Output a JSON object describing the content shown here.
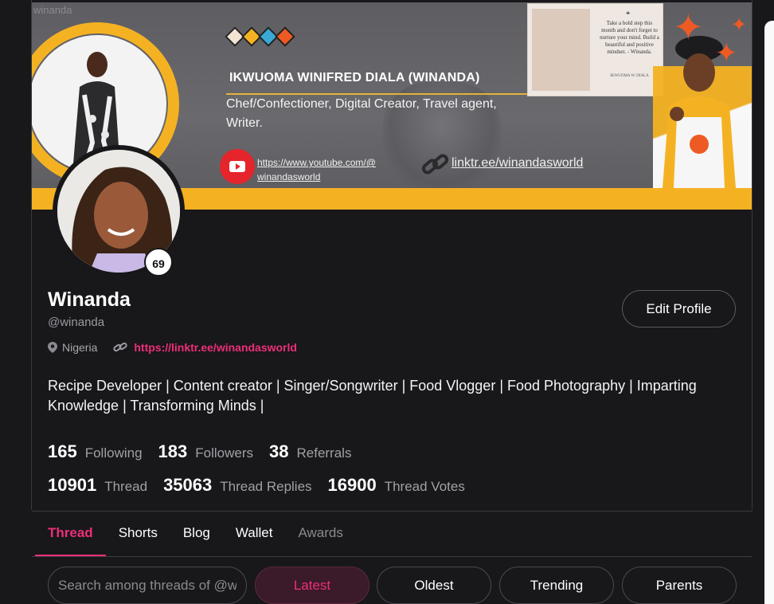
{
  "watermark": "winanda",
  "banner": {
    "name": "IKWUOMA WINIFRED DIALA (WINANDA)",
    "description": "Chef/Confectioner, Digital Creator, Travel agent, Writer.",
    "youtube_line1": "https://www.youtube.com/@",
    "youtube_line2": "winandasworld",
    "linktree": "linktr.ee/winandasworld",
    "quote_mark": "❝",
    "quote": "Take a bold step this month and don't forget to nurture your mind. Build a beautiful and positive mindset. - Winanda.",
    "quote_signature": "IKWUOMA W. DIALA",
    "diamond_colors": [
      "#f3e3d3",
      "#f4b223",
      "#3aa9d6",
      "#ee5a24"
    ],
    "accent_color": "#f4b223"
  },
  "profile": {
    "level": "69",
    "display_name": "Winanda",
    "handle": "@winanda",
    "location": "Nigeria",
    "link": "https://linktr.ee/winandasworld",
    "edit_button": "Edit Profile",
    "bio": "Recipe Developer | Content creator | Singer/Songwriter | Food Vlogger | Food Photography | Imparting Knowledge | Transforming Minds |"
  },
  "stats_row1": [
    {
      "value": "165",
      "label": "Following"
    },
    {
      "value": "183",
      "label": "Followers"
    },
    {
      "value": "38",
      "label": "Referrals"
    }
  ],
  "stats_row2": [
    {
      "value": "10901",
      "label": "Thread"
    },
    {
      "value": "35063",
      "label": "Thread Replies"
    },
    {
      "value": "16900",
      "label": "Thread Votes"
    }
  ],
  "tabs": [
    {
      "label": "Thread",
      "state": "active"
    },
    {
      "label": "Shorts",
      "state": "normal"
    },
    {
      "label": "Blog",
      "state": "normal"
    },
    {
      "label": "Wallet",
      "state": "normal"
    },
    {
      "label": "Awards",
      "state": "disabled"
    }
  ],
  "search": {
    "placeholder": "Search among threads of @winanda"
  },
  "filters": {
    "latest": "Latest",
    "oldest": "Oldest",
    "trending": "Trending",
    "parents": "Parents"
  },
  "colors": {
    "accent_pink": "#ec2f7a",
    "background": "#18171a",
    "youtube_red": "#e5242b"
  }
}
